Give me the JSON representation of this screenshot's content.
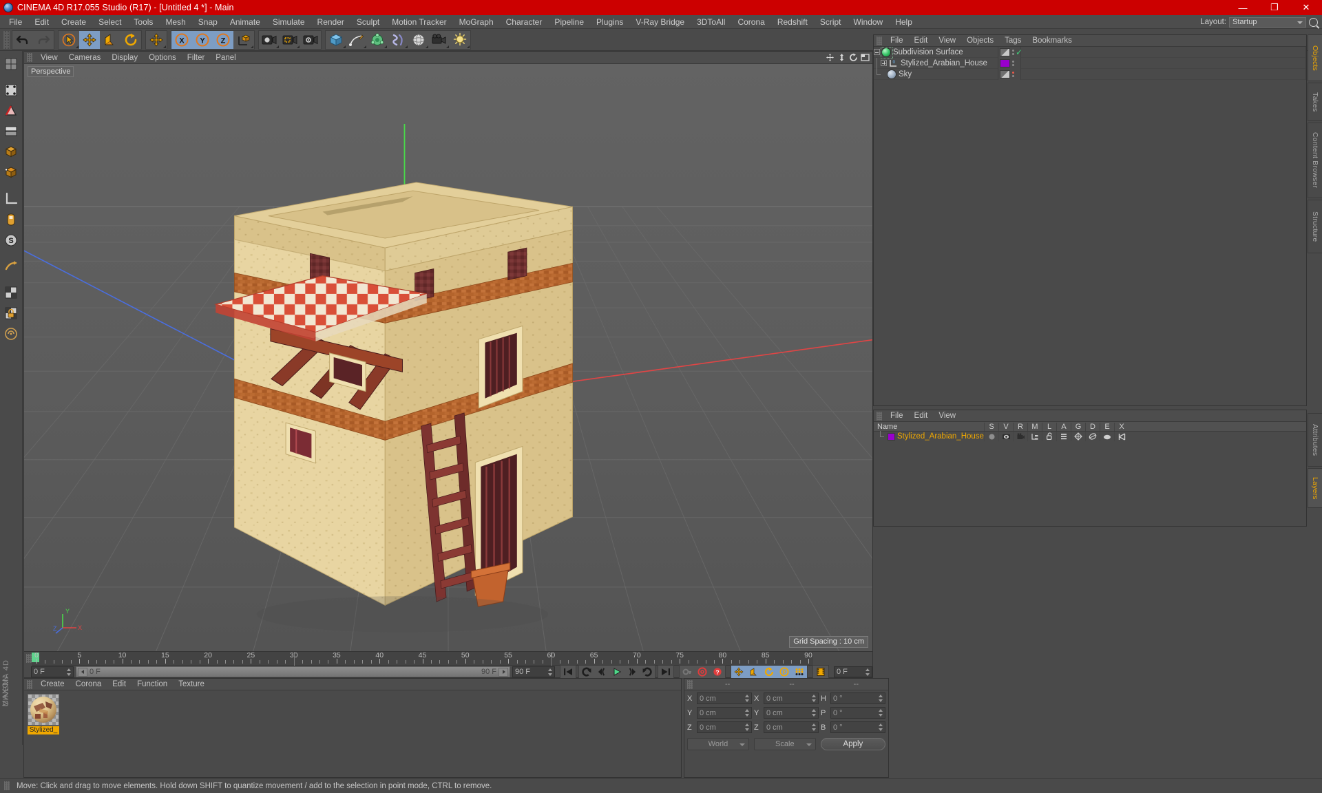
{
  "window": {
    "title": "CINEMA 4D R17.055 Studio (R17) - [Untitled 4 *] - Main",
    "logo_icon": "cinema4d-logo-icon",
    "minimize": "—",
    "maximize": "❐",
    "close": "✕",
    "titlebar_color": "#cc0000"
  },
  "menubar": {
    "items": [
      {
        "label": "File"
      },
      {
        "label": "Edit"
      },
      {
        "label": "Create"
      },
      {
        "label": "Select"
      },
      {
        "label": "Tools"
      },
      {
        "label": "Mesh"
      },
      {
        "label": "Snap"
      },
      {
        "label": "Animate"
      },
      {
        "label": "Simulate"
      },
      {
        "label": "Render"
      },
      {
        "label": "Sculpt"
      },
      {
        "label": "Motion Tracker"
      },
      {
        "label": "MoGraph"
      },
      {
        "label": "Character"
      },
      {
        "label": "Pipeline"
      },
      {
        "label": "Plugins"
      },
      {
        "label": "V-Ray Bridge"
      },
      {
        "label": "3DToAll"
      },
      {
        "label": "Corona"
      },
      {
        "label": "Redshift"
      },
      {
        "label": "Script"
      },
      {
        "label": "Window"
      },
      {
        "label": "Help"
      }
    ],
    "layout_label": "Layout:",
    "layout_value": "Startup",
    "search_icon": "magnifier-icon"
  },
  "toolbar": {
    "groups": [
      {
        "name": "history",
        "buttons": [
          {
            "name": "undo-button",
            "icon": "undo-arrow-icon",
            "active": false
          },
          {
            "name": "redo-button",
            "icon": "redo-arrow-icon",
            "active": false
          }
        ]
      },
      {
        "name": "transform-tools",
        "buttons": [
          {
            "name": "select-tool-button",
            "icon": "cursor-circle-icon",
            "active": false
          },
          {
            "name": "move-tool-button",
            "icon": "move-arrows-icon",
            "active": true
          },
          {
            "name": "scale-tool-button",
            "icon": "scale-box-icon",
            "active": false
          },
          {
            "name": "rotate-tool-button",
            "icon": "rotate-circle-icon",
            "active": false
          }
        ]
      },
      {
        "name": "world-axis",
        "buttons": [
          {
            "name": "move-axis-button",
            "icon": "move-arrows-icon",
            "active": false
          }
        ]
      },
      {
        "name": "axis-locks",
        "buttons": [
          {
            "name": "lock-x-button",
            "icon": "axis-x-icon",
            "active": true
          },
          {
            "name": "lock-y-button",
            "icon": "axis-y-icon",
            "active": true
          },
          {
            "name": "lock-z-button",
            "icon": "axis-z-icon",
            "active": true
          },
          {
            "name": "world-coordinate-button",
            "icon": "world-cube-icon",
            "active": false
          }
        ]
      },
      {
        "name": "render-group",
        "buttons": [
          {
            "name": "render-view-button",
            "icon": "render-view-icon",
            "active": false
          },
          {
            "name": "render-region-button",
            "icon": "render-region-icon",
            "active": false
          },
          {
            "name": "render-settings-button",
            "icon": "render-settings-icon",
            "active": false
          }
        ]
      },
      {
        "name": "primitives",
        "buttons": [
          {
            "name": "cube-primitive-button",
            "icon": "cube-icon",
            "active": false
          },
          {
            "name": "spline-pen-button",
            "icon": "pen-icon",
            "active": false
          },
          {
            "name": "generator-button",
            "icon": "nurbs-icon",
            "active": false
          },
          {
            "name": "deformer-button",
            "icon": "deformer-icon",
            "active": false
          },
          {
            "name": "environment-button",
            "icon": "sphere-env-icon",
            "active": false
          },
          {
            "name": "camera-button",
            "icon": "camera-icon",
            "active": false
          },
          {
            "name": "light-button",
            "icon": "light-icon",
            "active": false
          }
        ]
      }
    ]
  },
  "left_palette": {
    "buttons": [
      {
        "name": "editor-display-button",
        "icon": "display-mode-icon",
        "active": false
      },
      {
        "name": "point-mode-button",
        "icon": "point-mode-icon",
        "active": false
      },
      {
        "name": "edge-mode-button",
        "icon": "edge-mode-icon",
        "active": false
      },
      {
        "name": "polygon-mode-button",
        "icon": "polygon-mode-icon",
        "active": false
      },
      {
        "name": "model-mode-button",
        "icon": "model-mode-icon",
        "active": false
      },
      {
        "name": "object-mode-button",
        "icon": "object-mode-icon",
        "active": false
      },
      {
        "name": "texture-mode-button",
        "icon": "texture-axis-icon",
        "active": false
      },
      {
        "name": "workplane-button",
        "icon": "workplane-icon",
        "active": false
      },
      {
        "name": "ruler-button",
        "icon": "ruler-icon",
        "active": false
      },
      {
        "name": "uv-points-button",
        "icon": "uv-points-icon",
        "active": false
      },
      {
        "name": "uv-polygons-button",
        "icon": "uv-polygons-icon",
        "active": false
      },
      {
        "name": "snap-button",
        "icon": "magnet-icon",
        "active": false
      },
      {
        "name": "quantize-button",
        "icon": "quantize-icon",
        "active": false
      },
      {
        "name": "lock-axis-button",
        "icon": "lock-icon",
        "active": false
      },
      {
        "name": "viewport-solo-button",
        "icon": "solo-icon",
        "active": false
      }
    ]
  },
  "viewport": {
    "menu": [
      {
        "label": "View"
      },
      {
        "label": "Cameras"
      },
      {
        "label": "Display"
      },
      {
        "label": "Options"
      },
      {
        "label": "Filter"
      },
      {
        "label": "Panel"
      }
    ],
    "label": "Perspective",
    "grid_spacing": "Grid Spacing : 10 cm",
    "nav_icons": [
      "pan-view-icon",
      "dolly-view-icon",
      "rotate-view-icon",
      "maximize-view-icon"
    ],
    "axis_gizmo": {
      "x": "X",
      "y": "Y",
      "z": "Z"
    },
    "scene_description": "Stylized Arabian house 3D model with checkered awning, ladder and roof terrace"
  },
  "timeline": {
    "ticks": [
      0,
      5,
      10,
      15,
      20,
      25,
      30,
      35,
      40,
      45,
      50,
      55,
      60,
      65,
      70,
      75,
      80,
      85,
      90
    ],
    "range_start": 0,
    "range_end": 90,
    "current_frame_field": "0 F",
    "start_field": "0 F",
    "preview_end_field": "90 F",
    "end_field": "90 F",
    "right_frame_field": "0 F",
    "transport": [
      {
        "name": "go-to-start-button",
        "icon": "skip-start-icon"
      },
      {
        "name": "play-backwards-button",
        "icon": "rewind-loop-icon"
      },
      {
        "name": "previous-key-button",
        "icon": "prev-key-icon"
      },
      {
        "name": "play-button",
        "icon": "play-triangle-icon"
      },
      {
        "name": "next-key-button",
        "icon": "next-key-icon"
      },
      {
        "name": "play-forwards-button",
        "icon": "forward-loop-icon"
      },
      {
        "name": "go-to-end-button",
        "icon": "skip-end-icon"
      }
    ],
    "record_group": [
      {
        "name": "autokeying-button",
        "icon": "key-icon"
      },
      {
        "name": "record-active-objects-button",
        "icon": "record-circle-icon"
      },
      {
        "name": "keyframe-selection-button",
        "icon": "question-key-icon"
      }
    ],
    "param_group": [
      {
        "name": "position-key-button",
        "icon": "move-arrows-icon",
        "active": true
      },
      {
        "name": "scale-key-button",
        "icon": "scale-box-icon",
        "active": true
      },
      {
        "name": "rotation-key-button",
        "icon": "rotate-circle-icon",
        "active": true
      },
      {
        "name": "parameter-key-button",
        "icon": "param-p-icon",
        "active": true
      },
      {
        "name": "point-level-anim-button",
        "icon": "pla-dots-icon",
        "active": true
      }
    ],
    "timeline_button": {
      "name": "open-timeline-button",
      "icon": "film-strip-icon"
    }
  },
  "material_manager": {
    "menu": [
      {
        "label": "Create"
      },
      {
        "label": "Corona"
      },
      {
        "label": "Edit"
      },
      {
        "label": "Function"
      },
      {
        "label": "Texture"
      }
    ],
    "materials": [
      {
        "name": "Stylized_",
        "selected": true
      }
    ]
  },
  "coordinates": {
    "header": [
      "--",
      "--",
      "--"
    ],
    "position": {
      "label_x": "X",
      "x": "0 cm",
      "label_y": "Y",
      "y": "0 cm",
      "label_z": "Z",
      "z": "0 cm"
    },
    "size": {
      "label_x": "X",
      "x": "0 cm",
      "label_y": "Y",
      "y": "0 cm",
      "label_z": "Z",
      "z": "0 cm"
    },
    "rotation": {
      "label_h": "H",
      "h": "0 °",
      "label_p": "P",
      "p": "0 °",
      "label_b": "B",
      "b": "0 °"
    },
    "system": "World",
    "mode": "Scale",
    "apply": "Apply"
  },
  "object_manager": {
    "menu": [
      {
        "label": "File"
      },
      {
        "label": "Edit"
      },
      {
        "label": "View"
      },
      {
        "label": "Objects"
      },
      {
        "label": "Tags"
      },
      {
        "label": "Bookmarks"
      }
    ],
    "rows": [
      {
        "name": "Subdivision Surface",
        "icon": "subdivision-surface-icon",
        "depth": 0,
        "expander": "minus",
        "tag": "checkerboard-tag",
        "enabled_mark": "✓"
      },
      {
        "name": "Stylized_Arabian_House",
        "icon": "null-object-icon",
        "depth": 1,
        "expander": "plus",
        "tag": "material-tag",
        "tag_color": "#9900cc"
      },
      {
        "name": "Sky",
        "icon": "sky-object-icon",
        "depth": 1,
        "expander": "none",
        "tag": "checkerboard-tag",
        "marker": "red-dot"
      }
    ]
  },
  "layer_manager": {
    "menu": [
      {
        "label": "File"
      },
      {
        "label": "Edit"
      },
      {
        "label": "View"
      }
    ],
    "columns": [
      "Name",
      "S",
      "V",
      "R",
      "M",
      "L",
      "A",
      "G",
      "D",
      "E",
      "X"
    ],
    "rows": [
      {
        "name": "Stylized_Arabian_House",
        "color": "#9900cc",
        "icons": [
          "solo-dot-icon",
          "visible-eye-icon",
          "render-camera-icon",
          "manager-tree-icon",
          "lock-open-icon",
          "animation-bars-icon",
          "generator-icon",
          "deformer-icon",
          "expression-icon",
          "xref-icon"
        ]
      }
    ]
  },
  "side_tabs": {
    "top": [
      {
        "label": "Objects",
        "active": true
      },
      {
        "label": "Takes",
        "active": false
      },
      {
        "label": "Content Browser",
        "active": false
      },
      {
        "label": "Structure",
        "active": false
      }
    ],
    "bottom": [
      {
        "label": "Attributes",
        "active": false
      },
      {
        "label": "Layers",
        "active": true
      }
    ]
  },
  "branding": {
    "line1": "MAXON",
    "line2": "CINEMA 4D"
  },
  "statusbar": {
    "icon": "status-grip-icon",
    "text": "Move: Click and drag to move elements. Hold down SHIFT to quantize movement / add to the selection in point mode, CTRL to remove."
  }
}
